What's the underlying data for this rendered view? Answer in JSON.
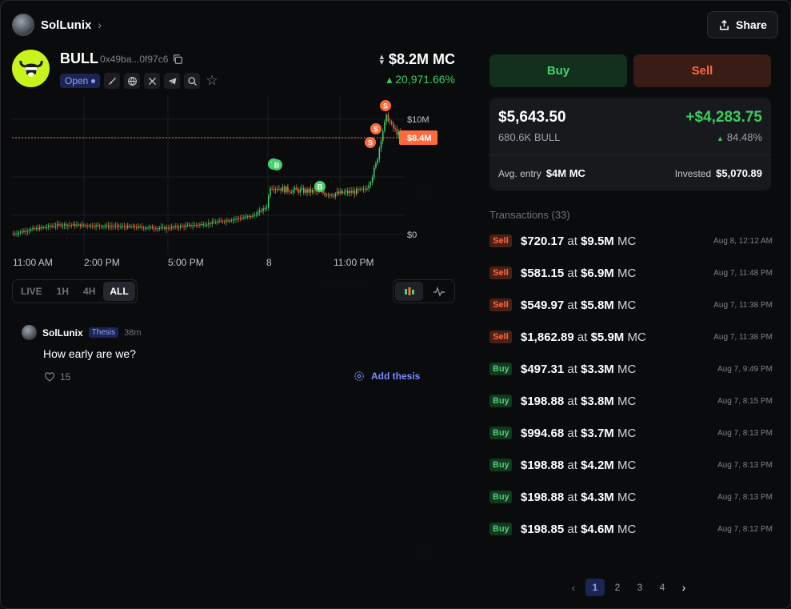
{
  "header": {
    "app_name": "SolLunix"
  },
  "share_label": "Share",
  "token": {
    "ticker": "BULL",
    "address": "0x49ba...0f97c6",
    "status": "Open",
    "market_cap": "$8.2M MC",
    "change": "20,971.66%"
  },
  "chart": {
    "price_line_label": "$8.4M",
    "y_top_label": "$10M",
    "y_bottom_label": "$0",
    "x_labels": [
      "11:00 AM",
      "2:00 PM",
      "5:00 PM",
      "8",
      "11:00 PM"
    ]
  },
  "chart_data": {
    "type": "candlestick",
    "unit": "market cap ($M)",
    "ylim": [
      0,
      10
    ],
    "current_value": 8.4,
    "markers": [
      {
        "label": "B",
        "kind": "buy"
      },
      {
        "label": "B",
        "kind": "buy"
      },
      {
        "label": "B",
        "kind": "buy"
      },
      {
        "label": "S",
        "kind": "sell"
      },
      {
        "label": "S",
        "kind": "sell"
      },
      {
        "label": "S",
        "kind": "sell"
      }
    ]
  },
  "timeframes": [
    "LIVE",
    "1H",
    "4H",
    "ALL"
  ],
  "active_timeframe": "ALL",
  "thesis": {
    "user": "SolLunix",
    "badge": "Thesis",
    "time": "38m",
    "text": "How early are we?",
    "likes": "15",
    "add_label": "Add thesis"
  },
  "trade": {
    "buy_label": "Buy",
    "sell_label": "Sell"
  },
  "position": {
    "value": "$5,643.50",
    "quantity": "680.6K BULL",
    "pnl": "+$4,283.75",
    "pnl_pct": "84.48%",
    "avg_entry_label": "Avg. entry",
    "avg_entry": "$4M MC",
    "invested_label": "Invested",
    "invested": "$5,070.89"
  },
  "transactions_title": "Transactions (33)",
  "transactions": [
    {
      "type": "Sell",
      "amount": "$720.17",
      "at": "at",
      "mc": "$9.5M",
      "mc_suffix": "MC",
      "time": "Aug 8, 12:12 AM"
    },
    {
      "type": "Sell",
      "amount": "$581.15",
      "at": "at",
      "mc": "$6.9M",
      "mc_suffix": "MC",
      "time": "Aug 7, 11:48 PM"
    },
    {
      "type": "Sell",
      "amount": "$549.97",
      "at": "at",
      "mc": "$5.8M",
      "mc_suffix": "MC",
      "time": "Aug 7, 11:38 PM"
    },
    {
      "type": "Sell",
      "amount": "$1,862.89",
      "at": "at",
      "mc": "$5.9M",
      "mc_suffix": "MC",
      "time": "Aug 7, 11:38 PM"
    },
    {
      "type": "Buy",
      "amount": "$497.31",
      "at": "at",
      "mc": "$3.3M",
      "mc_suffix": "MC",
      "time": "Aug 7, 9:49 PM"
    },
    {
      "type": "Buy",
      "amount": "$198.88",
      "at": "at",
      "mc": "$3.8M",
      "mc_suffix": "MC",
      "time": "Aug 7, 8:15 PM"
    },
    {
      "type": "Buy",
      "amount": "$994.68",
      "at": "at",
      "mc": "$3.7M",
      "mc_suffix": "MC",
      "time": "Aug 7, 8:13 PM"
    },
    {
      "type": "Buy",
      "amount": "$198.88",
      "at": "at",
      "mc": "$4.2M",
      "mc_suffix": "MC",
      "time": "Aug 7, 8:13 PM"
    },
    {
      "type": "Buy",
      "amount": "$198.88",
      "at": "at",
      "mc": "$4.3M",
      "mc_suffix": "MC",
      "time": "Aug 7, 8:13 PM"
    },
    {
      "type": "Buy",
      "amount": "$198.85",
      "at": "at",
      "mc": "$4.6M",
      "mc_suffix": "MC",
      "time": "Aug 7, 8:12 PM"
    }
  ],
  "pagination": {
    "pages": [
      "1",
      "2",
      "3",
      "4"
    ],
    "active": "1"
  },
  "colors": {
    "buy": "#45d26b",
    "sell": "#ff6a3a",
    "accent": "#8ea1ff",
    "logo": "#c9f31d"
  }
}
